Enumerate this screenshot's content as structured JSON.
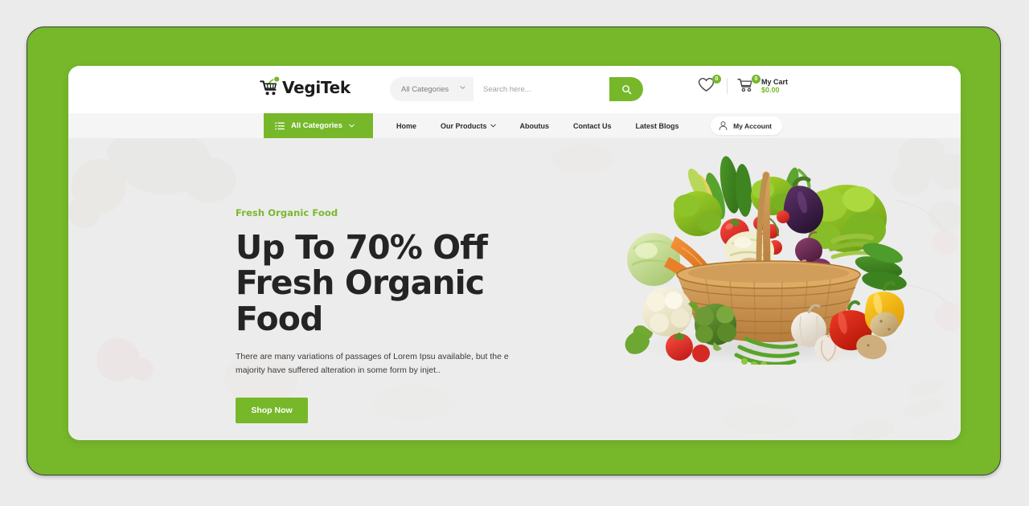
{
  "theme": {
    "brand_green": "#76b82a",
    "page_bg": "#ebebeb",
    "hero_bg": "#ececec",
    "nav_bg": "#f5f5f5",
    "headline_color": "#242424"
  },
  "header": {
    "logo": {
      "icon": "shopping-cart-icon",
      "brand": "VegiTek"
    },
    "search": {
      "category_value": "All Categories",
      "placeholder": "Search here...",
      "input_value": "",
      "button_icon": "search-icon"
    },
    "actions": {
      "wishlist": {
        "icon": "heart-icon",
        "count": "0"
      },
      "cart": {
        "icon": "cart-icon",
        "count": "0",
        "label": "My Cart",
        "amount": "$0.00"
      }
    }
  },
  "nav": {
    "all_categories": {
      "icon": "list-icon",
      "label": "All Categories",
      "caret": "⌄"
    },
    "menu": [
      {
        "label": "Home",
        "has_caret": false
      },
      {
        "label": "Our Products",
        "has_caret": true
      },
      {
        "label": "Aboutus",
        "has_caret": false
      },
      {
        "label": "Contact Us",
        "has_caret": false
      },
      {
        "label": "Latest Blogs",
        "has_caret": false
      }
    ],
    "account": {
      "icon": "user-icon",
      "label": "My Account"
    }
  },
  "hero": {
    "eyebrow": "Fresh Organic Food",
    "headline": "Up To 70% Off Fresh Organic Food",
    "subcopy": "There are many variations of passages of Lorem Ipsu available, but the e majority have suffered alteration in some form by injet..",
    "cta_label": "Shop Now",
    "image_alt": "basket-of-vegetables"
  }
}
